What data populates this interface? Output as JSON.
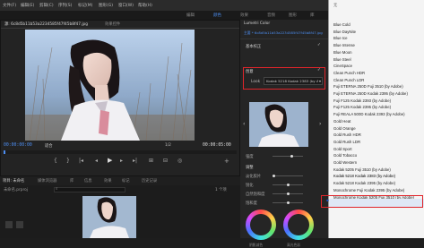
{
  "menubar": {
    "items": [
      "文件(F)",
      "编辑(E)",
      "剪辑(C)",
      "序列(S)",
      "标记(M)",
      "图形(G)",
      "窗口(W)",
      "帮助(H)"
    ],
    "active_tab": "编辑"
  },
  "workspace_tabs": [
    "编辑",
    "颜色",
    "效果",
    "音频",
    "图形",
    "库"
  ],
  "source_panel": {
    "tabs": [
      "源: 6c8d5b11b53a2234585f47f45b8f47.jpg",
      "效果控件"
    ],
    "timecode_left": "00:00:00:00",
    "fit_label": "适合",
    "ratio": "1/2",
    "timecode_right": "00:00:05:00"
  },
  "program_panel": {
    "time_left": "00:00:00:00",
    "time_right": "00:00:05:00"
  },
  "lumetri": {
    "title": "Lumetri Color",
    "clip_label": "主要 * 6c8d5b11b53a2234585f47f45b8f47.jpg",
    "sections": [
      "基本校正",
      "创意"
    ],
    "look_label": "Look",
    "look_value": "Kodak 5218 Kodak 2383 (by Adobe)",
    "rows": [
      "强度",
      "调整",
      "淡化胶片",
      "锐化",
      "自然饱和度",
      "饱和度"
    ],
    "wheel_labels": [
      "阴影减色",
      "高光色彩"
    ]
  },
  "bottom_panel": {
    "tabs": [
      "项目: 未命名",
      "媒体浏览器",
      "库",
      "信息",
      "效果",
      "标记",
      "历史记录"
    ],
    "item_count": "1 个项",
    "project_file": "未命名.prproj"
  },
  "dropdown": {
    "items": [
      "Blue Cold",
      "Blue DayNite",
      "Blue Ice",
      "Blue Intense",
      "Blue Moon",
      "Blue Steel",
      "CineSpace",
      "Clean Punch HDR",
      "Clean Punch LDR",
      "Fuji ETERNA 250D Fuji 3510 (by Adobe)",
      "Fuji ETERNA 250D Kodak 2395 (by Adobe)",
      "Fuji F125 Kodak 2393 (by Adobe)",
      "Fuji F125 Kodak 2395 (by Adobe)",
      "Fuji REALA 500D Kodak 2393 (by Adobe)",
      "Gold Heat",
      "Gold Orange",
      "Gold Rush HDR",
      "Gold Rush LDR",
      "Gold Sport",
      "Gold Tobacco",
      "Gold Western",
      "Kodak 5205 Fuji 3510 (by Adobe)",
      "Kodak 5218 Kodak 2383 (by Adobe)",
      "Kodak 5218 Kodak 2395 (by Adobe)",
      "Monochrome Fuji Kodak 2395 (by Adobe)",
      "Monochrome Kodak 5205 Fuji 3510 (by Adobe)",
      "Monochrome Kodak 2393 (by Adobe)"
    ],
    "top_label": "无",
    "selected_index": 22
  },
  "colors": {
    "accent": "#4c8df0",
    "highlight": "#e0252b"
  }
}
